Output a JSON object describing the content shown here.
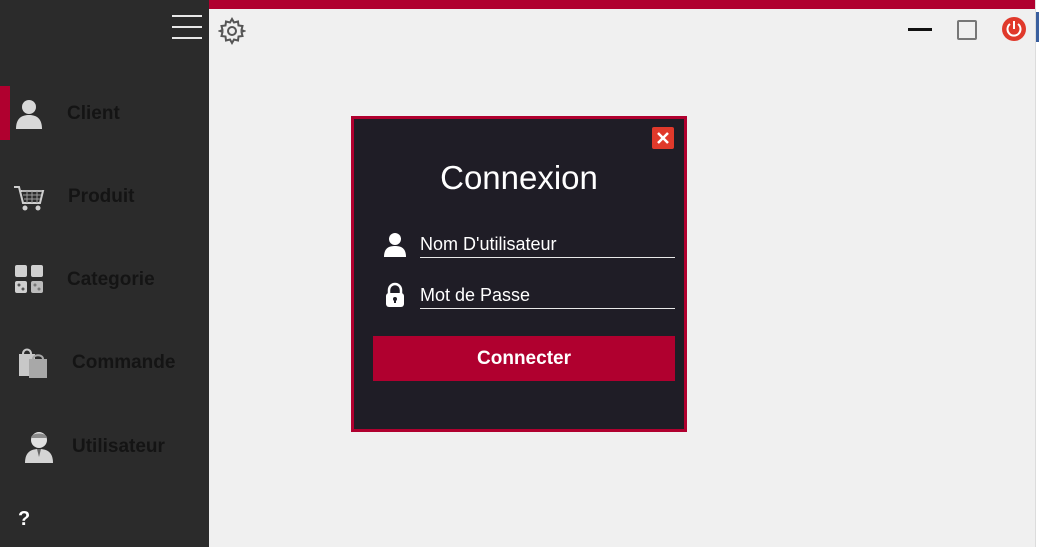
{
  "sidebar": {
    "items": [
      {
        "label": "Client",
        "icon": "user-icon",
        "active": true
      },
      {
        "label": "Produit",
        "icon": "cart-icon"
      },
      {
        "label": "Categorie",
        "icon": "grid-icon"
      },
      {
        "label": "Commande",
        "icon": "shopping-bags-icon"
      },
      {
        "label": "Utilisateur",
        "icon": "person-avatar-icon"
      }
    ],
    "help_label": "?"
  },
  "login": {
    "title": "Connexion",
    "username_placeholder": "Nom D'utilisateur",
    "password_placeholder": "Mot de Passe",
    "submit_label": "Connecter"
  },
  "colors": {
    "accent": "#b0002f",
    "sidebar_bg": "#2b2b2b",
    "dialog_bg": "#1f1d26",
    "content_bg": "#f0f0f0",
    "close_red": "#e0392b"
  }
}
